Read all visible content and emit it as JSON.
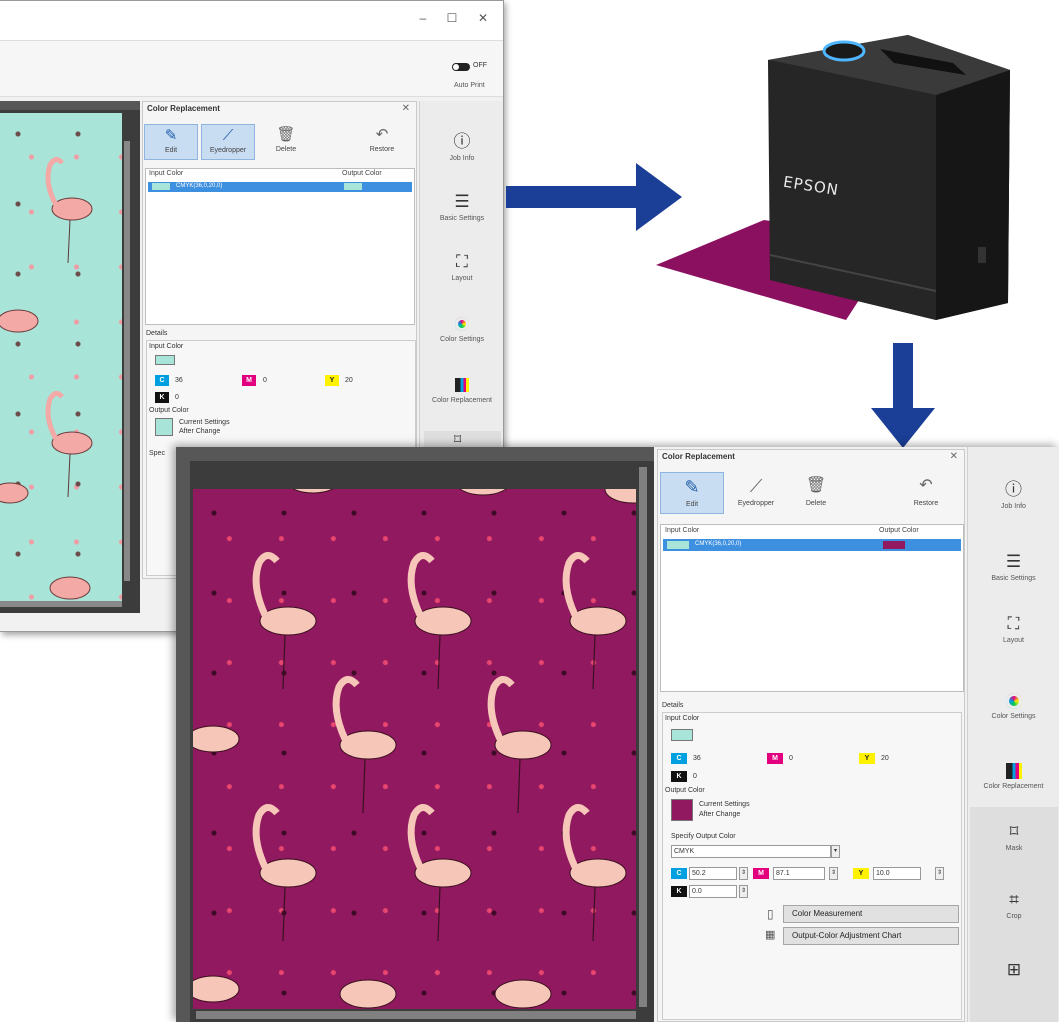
{
  "back_window": {
    "controls": {
      "minimize": "–",
      "maximize": "☐",
      "close": "✕"
    },
    "toggle_label": "OFF",
    "auto_print": "Auto Print",
    "panel": {
      "title": "Color Replacement",
      "tools": {
        "edit": "Edit",
        "eyedropper": "Eyedropper",
        "delete": "Delete",
        "restore": "Restore"
      },
      "input_color_head": "Input Color",
      "output_color_head": "Output Color",
      "row_text": "CMYK(36,0,20,0)",
      "details": "Details",
      "input_color": "Input Color",
      "c_label": "C",
      "c_val": "36",
      "m_label": "M",
      "m_val": "0",
      "y_label": "Y",
      "y_val": "20",
      "k_label": "K",
      "k_val": "0",
      "output_color": "Output Color",
      "current_settings": "Current Settings",
      "after_change": "After Change",
      "specify_partial": "Spec"
    },
    "sidebar": {
      "job_info": "Job Info",
      "basic_settings": "Basic Settings",
      "layout": "Layout",
      "color_settings": "Color Settings",
      "color_replacement": "Color Replacement"
    }
  },
  "device": {
    "brand": "EPSON"
  },
  "front_window": {
    "panel": {
      "title": "Color Replacement",
      "tools": {
        "edit": "Edit",
        "eyedropper": "Eyedropper",
        "delete": "Delete",
        "restore": "Restore"
      },
      "input_color_head": "Input Color",
      "output_color_head": "Output Color",
      "row_text": "CMYK(36,0,20,0)",
      "details": "Details",
      "input_color": "Input Color",
      "c_label": "C",
      "c_val": "36",
      "m_label": "M",
      "m_val": "0",
      "y_label": "Y",
      "y_val": "20",
      "k_label": "K",
      "k_val": "0",
      "output_color": "Output Color",
      "current_settings": "Current Settings",
      "after_change": "After Change",
      "specify_output": "Specify Output Color",
      "mode_value": "CMYK",
      "out_c": "50.2",
      "out_m": "87.1",
      "out_y": "10.0",
      "out_k": "0.0",
      "color_measurement": "Color Measurement",
      "adjustment_chart": "Output-Color Adjustment Chart"
    },
    "sidebar": {
      "job_info": "Job Info",
      "basic_settings": "Basic Settings",
      "layout": "Layout",
      "color_settings": "Color Settings",
      "color_replacement": "Color Replacement",
      "mask": "Mask",
      "crop": "Crop"
    }
  },
  "colors": {
    "mint": "#a9e4d9",
    "magenta_output": "#91195f",
    "arrow": "#1b3e96",
    "selection": "#3d8fe0"
  }
}
